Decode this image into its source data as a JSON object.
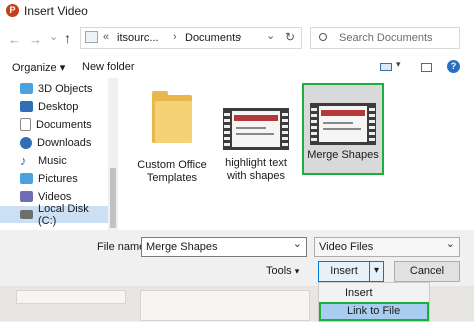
{
  "window": {
    "title": "Insert Video",
    "app_icon": "powerpoint-icon",
    "app_icon_letter": "P"
  },
  "nav": {
    "back_icon": "←",
    "forward_icon": "→",
    "recent_icon": "⌄",
    "up_icon": "↑",
    "chevrons": "«",
    "path": [
      "itsourc...",
      "Documents"
    ],
    "path_sep": "›",
    "path_dropdown": "⌄",
    "refresh_icon": "↻",
    "search_placeholder": "Search Documents"
  },
  "toolbar": {
    "organize_label": "Organize",
    "organize_arrow": "▾",
    "new_folder_label": "New folder",
    "view_arrow": "▾",
    "help_icon": "?"
  },
  "sidebar": {
    "items": [
      {
        "label": "3D Objects",
        "color": "#4aa3df"
      },
      {
        "label": "Desktop",
        "color": "#2f6fb5"
      },
      {
        "label": "Documents",
        "color": "#8a8a8a"
      },
      {
        "label": "Downloads",
        "color": "#2f6fb5"
      },
      {
        "label": "Music",
        "color": "#2f6fb5"
      },
      {
        "label": "Pictures",
        "color": "#4aa3df"
      },
      {
        "label": "Videos",
        "color": "#6f6fb5"
      },
      {
        "label": "Local Disk (C:)",
        "color": "#6e6e6e"
      }
    ]
  },
  "files": [
    {
      "label": "Custom Office Templates",
      "kind": "folder"
    },
    {
      "label": "highlight text with shapes",
      "kind": "video"
    },
    {
      "label": "Merge Shapes",
      "kind": "video",
      "selected": true
    }
  ],
  "bottom": {
    "filename_label": "File name:",
    "filename_value": "Merge Shapes",
    "filetype_value": "Video Files",
    "dropdown_arrow": "⌄",
    "tools_label": "Tools",
    "tools_arrow": "▾",
    "insert_label": "Insert",
    "insert_split_arrow": "▾",
    "cancel_label": "Cancel"
  },
  "insert_menu": {
    "items": [
      "Insert",
      "Link to File"
    ]
  },
  "colors": {
    "accent_green": "#1aaf3f",
    "selection_blue": "#cce0f5",
    "highlight_blue": "#a9cdee"
  }
}
